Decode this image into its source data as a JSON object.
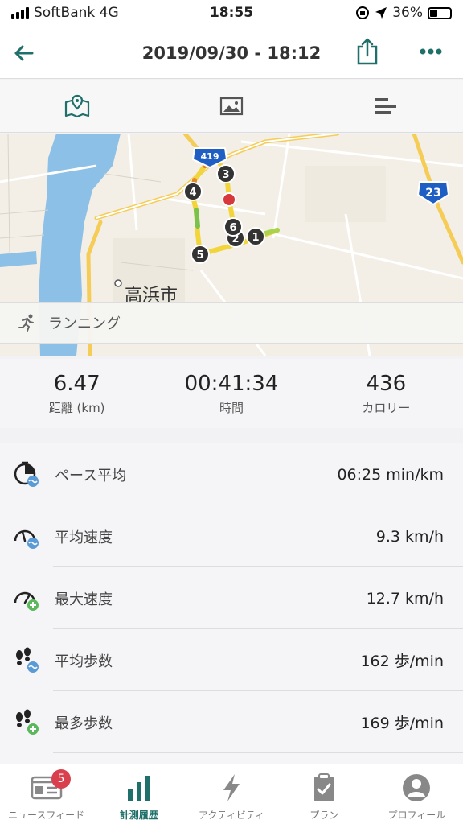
{
  "status_bar": {
    "carrier": "SoftBank 4G",
    "time": "18:55",
    "battery": "36%",
    "battery_level": 0.36
  },
  "header": {
    "title": "2019/09/30 - 18:12",
    "back_icon": "arrow-left-icon",
    "share_icon": "share-icon",
    "more_icon": "more-icon"
  },
  "view_tabs": [
    {
      "icon": "map-icon",
      "selected": true
    },
    {
      "icon": "image-icon",
      "selected": false
    },
    {
      "icon": "bar-chart-icon",
      "selected": false
    }
  ],
  "map": {
    "city_label": "高浜市",
    "route_shields": [
      "419",
      "23"
    ],
    "split_markers": [
      "1",
      "2",
      "3",
      "4",
      "5",
      "6"
    ]
  },
  "activity": {
    "label": "ランニング",
    "icon": "running-icon"
  },
  "summary": [
    {
      "value": "6.47",
      "label": "距離 (km)"
    },
    {
      "value": "00:41:34",
      "label": "時間"
    },
    {
      "value": "436",
      "label": "カロリー"
    }
  ],
  "metrics": [
    {
      "label": "ペース平均",
      "value": "06:25 min/km",
      "icon": "pace-average-icon"
    },
    {
      "label": "平均速度",
      "value": "9.3 km/h",
      "icon": "speed-average-icon"
    },
    {
      "label": "最大速度",
      "value": "12.7 km/h",
      "icon": "speed-max-icon"
    },
    {
      "label": "平均歩数",
      "value": "162 歩/min",
      "icon": "steps-average-icon"
    },
    {
      "label": "最多歩数",
      "value": "169 歩/min",
      "icon": "steps-max-icon"
    }
  ],
  "tabbar": [
    {
      "label": "ニュースフィード",
      "icon": "newsfeed-icon",
      "badge": "5",
      "active": false
    },
    {
      "label": "計測履歴",
      "icon": "history-chart-icon",
      "active": true
    },
    {
      "label": "アクティビティ",
      "icon": "lightning-icon",
      "active": false
    },
    {
      "label": "プラン",
      "icon": "clipboard-icon",
      "active": false
    },
    {
      "label": "プロフィール",
      "icon": "profile-icon",
      "active": false
    }
  ],
  "colors": {
    "accent": "#1f6f6a",
    "badge": "#d9404d",
    "route": "#f2d43b"
  }
}
